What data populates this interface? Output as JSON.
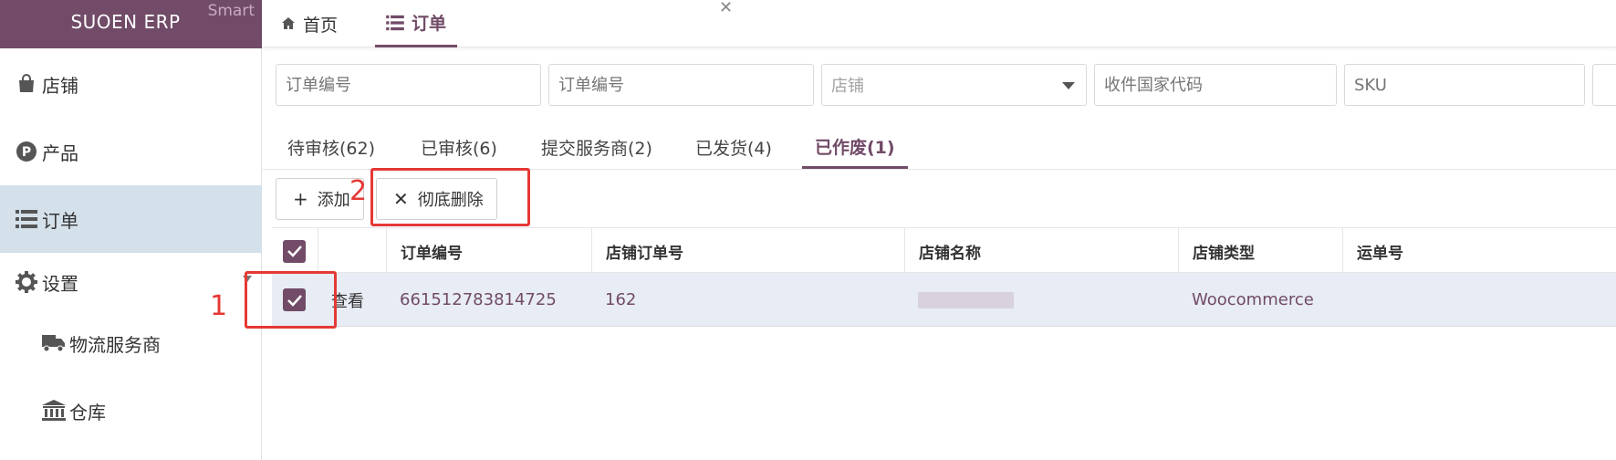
{
  "sidebar": {
    "brand": "SUOEN ERP",
    "brand_tag": "Smart",
    "items": [
      {
        "label": "店铺",
        "icon": "shopping-bag-icon"
      },
      {
        "label": "产品",
        "icon": "p-circle-icon"
      },
      {
        "label": "订单",
        "icon": "list-icon",
        "active": true
      },
      {
        "label": "设置",
        "icon": "gear-icon"
      },
      {
        "label": "物流服务商",
        "icon": "truck-icon"
      },
      {
        "label": "仓库",
        "icon": "bank-icon"
      }
    ]
  },
  "top_tabs": [
    {
      "label": "首页",
      "icon": "home-icon"
    },
    {
      "label": "订单",
      "icon": "list-icon",
      "active": true
    }
  ],
  "filters": [
    {
      "placeholder": "订单编号"
    },
    {
      "placeholder": "订单编号"
    },
    {
      "placeholder": "店铺",
      "type": "select"
    },
    {
      "placeholder": "收件国家代码"
    },
    {
      "placeholder": "SKU"
    }
  ],
  "status_tabs": [
    {
      "label": "待审核(62)"
    },
    {
      "label": "已审核(6)"
    },
    {
      "label": "提交服务商(2)"
    },
    {
      "label": "已发货(4)"
    },
    {
      "label": "已作废(1)",
      "active": true
    }
  ],
  "toolbar": {
    "add_label": "添加",
    "delete_label": "彻底删除"
  },
  "table": {
    "headers": [
      "订单编号",
      "店铺订单号",
      "店铺名称",
      "店铺类型",
      "运单号"
    ],
    "rows": [
      {
        "view": "查看",
        "order_no": "661512783814725",
        "store_order_no": "162",
        "store_name": "",
        "store_type": "Woocommerce",
        "tracking_no": ""
      }
    ]
  },
  "annotations": {
    "label_1": "1",
    "label_2": "2",
    "color": "#e53935"
  },
  "colors": {
    "brand": "#714b67",
    "active_nav": "#d4e0ea",
    "selected_row": "#e8ecf4"
  }
}
